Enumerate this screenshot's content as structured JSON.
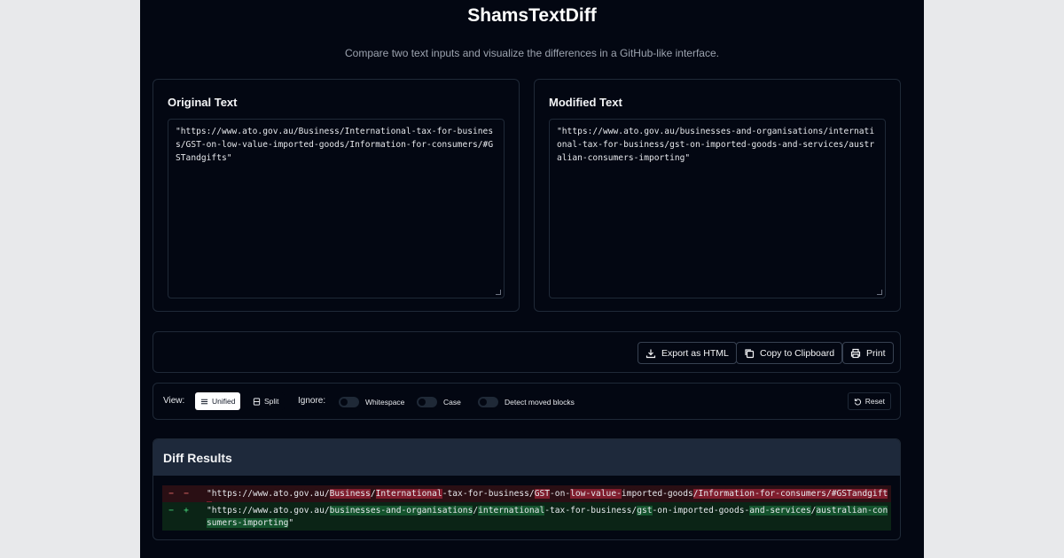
{
  "app": {
    "title": "ShamsTextDiff",
    "subtitle": "Compare two text inputs and visualize the differences in a GitHub-like interface."
  },
  "original": {
    "label": "Original Text",
    "value": "\"https://www.ato.gov.au/Business/International-tax-for-business/GST-on-low-value-imported-goods/Information-for-consumers/#GSTandgifts\""
  },
  "modified": {
    "label": "Modified Text",
    "value": "\"https://www.ato.gov.au/businesses-and-organisations/international-tax-for-business/gst-on-imported-goods-and-services/australian-consumers-importing\""
  },
  "actions": {
    "export_label": "Export as HTML",
    "copy_label": "Copy to Clipboard",
    "print_label": "Print"
  },
  "options": {
    "view_label": "View:",
    "unified_label": "Unified",
    "split_label": "Split",
    "ignore_label": "Ignore:",
    "whitespace_label": "Whitespace",
    "case_label": "Case",
    "moved_label": "Detect moved blocks",
    "reset_label": "Reset",
    "active_view": "Unified"
  },
  "results": {
    "title": "Diff Results",
    "removed": {
      "gutter_old": "−",
      "gutter_sign": "−",
      "segments": [
        {
          "text": "\"https://www.ato.gov.au/",
          "hl": false
        },
        {
          "text": "Business",
          "hl": true
        },
        {
          "text": "/",
          "hl": false
        },
        {
          "text": "International",
          "hl": true
        },
        {
          "text": "-tax-for-business/",
          "hl": false
        },
        {
          "text": "GST",
          "hl": true
        },
        {
          "text": "-on-",
          "hl": false
        },
        {
          "text": "low-value-",
          "hl": true
        },
        {
          "text": "imported-goods",
          "hl": false
        },
        {
          "text": "/Information-for-consumers/#GSTandgifts",
          "hl": true
        },
        {
          "text": "\"",
          "hl": false
        }
      ]
    },
    "added": {
      "gutter_old": "−",
      "gutter_sign": "+",
      "segments": [
        {
          "text": "\"https://www.ato.gov.au/",
          "hl": false
        },
        {
          "text": "businesses-and-organisations",
          "hl": true
        },
        {
          "text": "/",
          "hl": false
        },
        {
          "text": "international",
          "hl": true
        },
        {
          "text": "-tax-for-business/",
          "hl": false
        },
        {
          "text": "gst",
          "hl": true
        },
        {
          "text": "-on-imported-goods-",
          "hl": false
        },
        {
          "text": "and-services",
          "hl": true
        },
        {
          "text": "/",
          "hl": false
        },
        {
          "text": "australian-consumers-importing",
          "hl": true
        },
        {
          "text": "\"",
          "hl": false
        }
      ]
    }
  },
  "colors": {
    "removed_bg": "#2a0f14",
    "removed_highlight": "#7f1d2d",
    "added_bg": "#0b2416",
    "added_highlight": "#14532d"
  }
}
